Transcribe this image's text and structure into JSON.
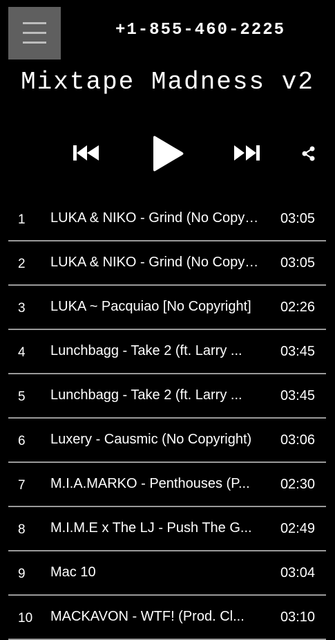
{
  "header": {
    "menu_icon": "hamburger-menu-icon",
    "phone": "+1-855-460-2225"
  },
  "app": {
    "title": "Mixtape Madness v2"
  },
  "controls": {
    "prev_icon": "skip-previous-icon",
    "play_icon": "play-icon",
    "next_icon": "skip-next-icon",
    "share_icon": "share-icon"
  },
  "tracks": [
    {
      "num": "1",
      "title": "LUKA & NIKO - Grind (No Copyright)",
      "duration": "03:05"
    },
    {
      "num": "2",
      "title": "LUKA & NIKO - Grind (No Copyright)",
      "duration": "03:05"
    },
    {
      "num": "3",
      "title": "LUKA ~ Pacquiao [No Copyright]",
      "duration": "02:26"
    },
    {
      "num": "4",
      "title": "Lunchbagg - Take 2 (ft. Larry ...",
      "duration": "03:45"
    },
    {
      "num": "5",
      "title": "Lunchbagg - Take 2 (ft. Larry ...",
      "duration": "03:45"
    },
    {
      "num": "6",
      "title": "Luxery - Causmic (No Copyright)",
      "duration": "03:06"
    },
    {
      "num": "7",
      "title": "M.I.A.MARKO - Penthouses (P...",
      "duration": "02:30"
    },
    {
      "num": "8",
      "title": "M.I.M.E x The LJ - Push The G...",
      "duration": "02:49"
    },
    {
      "num": "9",
      "title": "Mac 10",
      "duration": "03:04"
    },
    {
      "num": "10",
      "title": "MACKAVON - WTF! (Prod. Cl...",
      "duration": "03:10"
    }
  ]
}
